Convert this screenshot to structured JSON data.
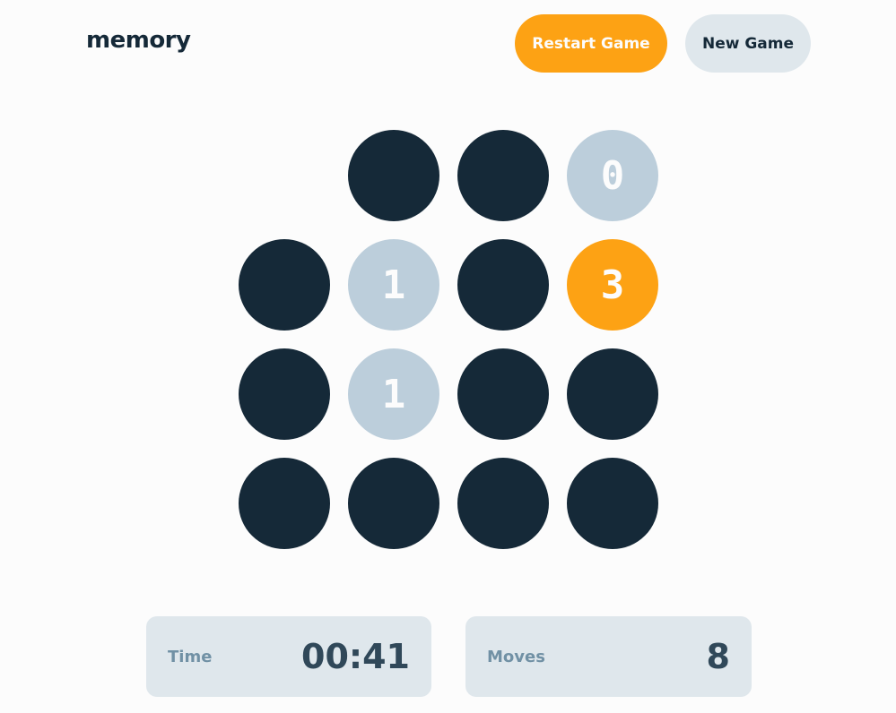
{
  "header": {
    "title": "memory",
    "restart_label": "Restart Game",
    "new_game_label": "New Game"
  },
  "board": {
    "rows": [
      [
        {
          "state": "empty",
          "value": ""
        },
        {
          "state": "hidden",
          "value": ""
        },
        {
          "state": "hidden",
          "value": ""
        },
        {
          "state": "matched",
          "value": "0"
        }
      ],
      [
        {
          "state": "hidden",
          "value": ""
        },
        {
          "state": "matched",
          "value": "1"
        },
        {
          "state": "hidden",
          "value": ""
        },
        {
          "state": "active",
          "value": "3"
        }
      ],
      [
        {
          "state": "hidden",
          "value": ""
        },
        {
          "state": "matched",
          "value": "1"
        },
        {
          "state": "hidden",
          "value": ""
        },
        {
          "state": "hidden",
          "value": ""
        }
      ],
      [
        {
          "state": "hidden",
          "value": ""
        },
        {
          "state": "hidden",
          "value": ""
        },
        {
          "state": "hidden",
          "value": ""
        },
        {
          "state": "hidden",
          "value": ""
        }
      ]
    ]
  },
  "stats": {
    "time_label": "Time",
    "time_value": "00:41",
    "moves_label": "Moves",
    "moves_value": "8"
  },
  "colors": {
    "hidden": "#152938",
    "matched": "#bccedb",
    "active": "#fda214",
    "background": "#fcfcfc",
    "panel": "#dfe7ec"
  }
}
